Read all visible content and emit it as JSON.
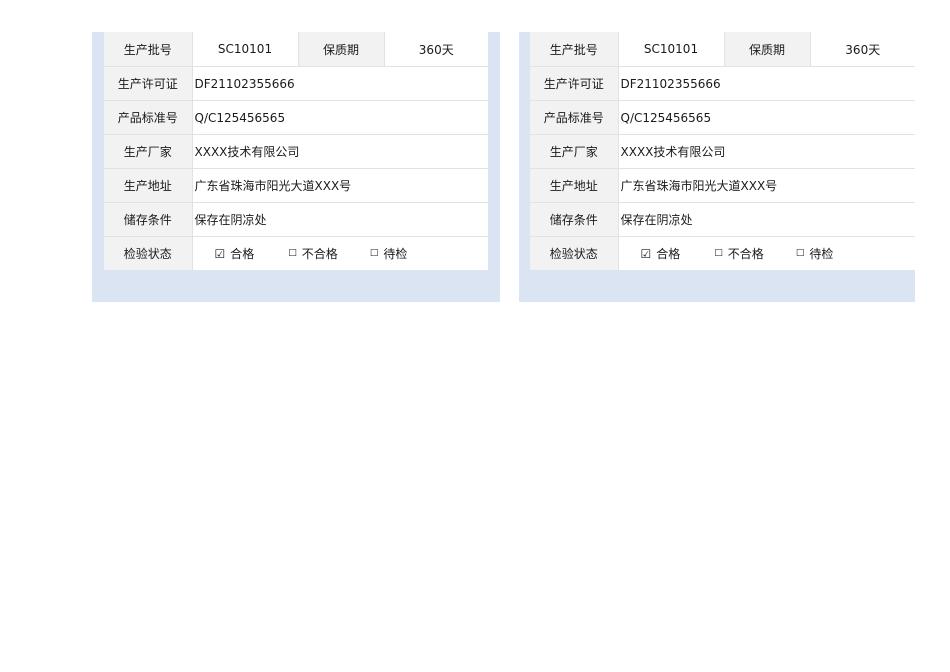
{
  "cards": [
    {
      "batch_label": "生产批号",
      "batch_value": "SC10101",
      "shelf_label": "保质期",
      "shelf_value": "360天",
      "license_label": "生产许可证",
      "license_value": "DF21102355666",
      "standard_label": "产品标准号",
      "standard_value": "Q/C125456565",
      "maker_label": "生产厂家",
      "maker_value": "XXXX技术有限公司",
      "address_label": "生产地址",
      "address_value": "广东省珠海市阳光大道XXX号",
      "storage_label": "储存条件",
      "storage_value": "保存在阴凉处",
      "status_label": "检验状态",
      "status_options": [
        {
          "box": "☑",
          "label": "合格",
          "checked": true
        },
        {
          "box": "□",
          "label": "不合格",
          "checked": false
        },
        {
          "box": "□",
          "label": "待检",
          "checked": false
        }
      ]
    },
    {
      "batch_label": "生产批号",
      "batch_value": "SC10101",
      "shelf_label": "保质期",
      "shelf_value": "360天",
      "license_label": "生产许可证",
      "license_value": "DF21102355666",
      "standard_label": "产品标准号",
      "standard_value": "Q/C125456565",
      "maker_label": "生产厂家",
      "maker_value": "XXXX技术有限公司",
      "address_label": "生产地址",
      "address_value": "广东省珠海市阳光大道XXX号",
      "storage_label": "储存条件",
      "storage_value": "保存在阴凉处",
      "status_label": "检验状态",
      "status_options": [
        {
          "box": "☑",
          "label": "合格",
          "checked": true
        },
        {
          "box": "□",
          "label": "不合格",
          "checked": false
        },
        {
          "box": "□",
          "label": "待检",
          "checked": false
        }
      ]
    }
  ]
}
